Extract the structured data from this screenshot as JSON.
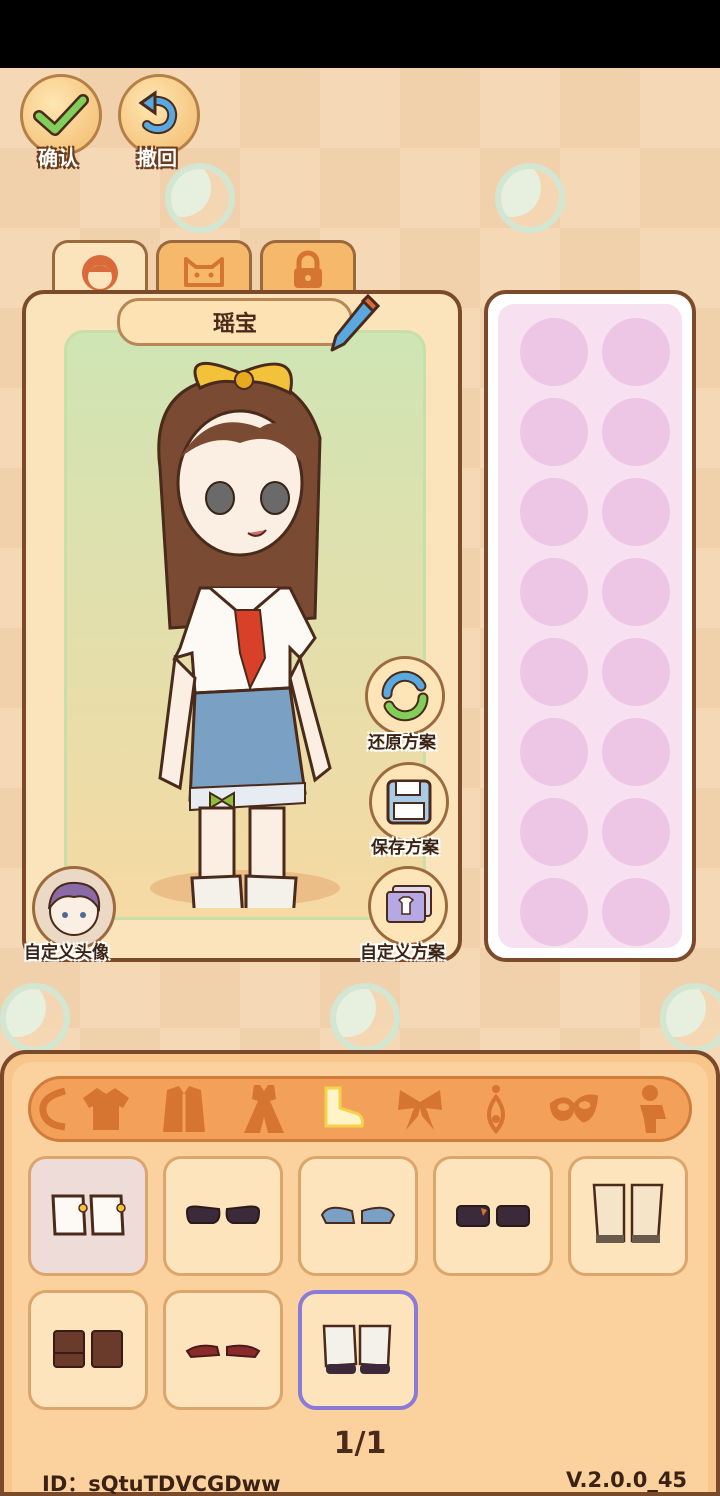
{
  "top_buttons": {
    "confirm_label": "确认",
    "undo_label": "撤回"
  },
  "character": {
    "name": "瑶宝"
  },
  "tabs": [
    {
      "icon": "face-icon",
      "active": true
    },
    {
      "icon": "cat-icon",
      "active": false
    },
    {
      "icon": "lock-icon",
      "active": false
    }
  ],
  "actions": {
    "restore_label": "还原方案",
    "save_label": "保存方案",
    "custom_scheme_label": "自定义方案",
    "custom_avatar_label": "自定义头像"
  },
  "categories": [
    {
      "icon": "hair-icon",
      "active": false
    },
    {
      "icon": "top-icon",
      "active": false
    },
    {
      "icon": "coat-icon",
      "active": false
    },
    {
      "icon": "dress-icon",
      "active": false
    },
    {
      "icon": "shoe-icon",
      "active": true
    },
    {
      "icon": "bow-icon",
      "active": false
    },
    {
      "icon": "earring-icon",
      "active": false
    },
    {
      "icon": "mask-icon",
      "active": false
    },
    {
      "icon": "figure-icon",
      "active": false
    }
  ],
  "items": [
    {
      "icon": "sock-boot-icon",
      "selected": false
    },
    {
      "icon": "black-flat-shoe-icon",
      "selected": false
    },
    {
      "icon": "blue-sandal-icon",
      "selected": false
    },
    {
      "icon": "black-shoe-icon",
      "selected": false
    },
    {
      "icon": "beige-boot-icon",
      "selected": false
    },
    {
      "icon": "brown-boot-icon",
      "selected": false
    },
    {
      "icon": "red-sandal-icon",
      "selected": false
    },
    {
      "icon": "leg-warmer-icon",
      "selected": true
    }
  ],
  "pagination": {
    "text": "1/1"
  },
  "footer": {
    "id_text": "ID：sQtuTDVCGDww",
    "version": "V.2.0.0_45"
  }
}
